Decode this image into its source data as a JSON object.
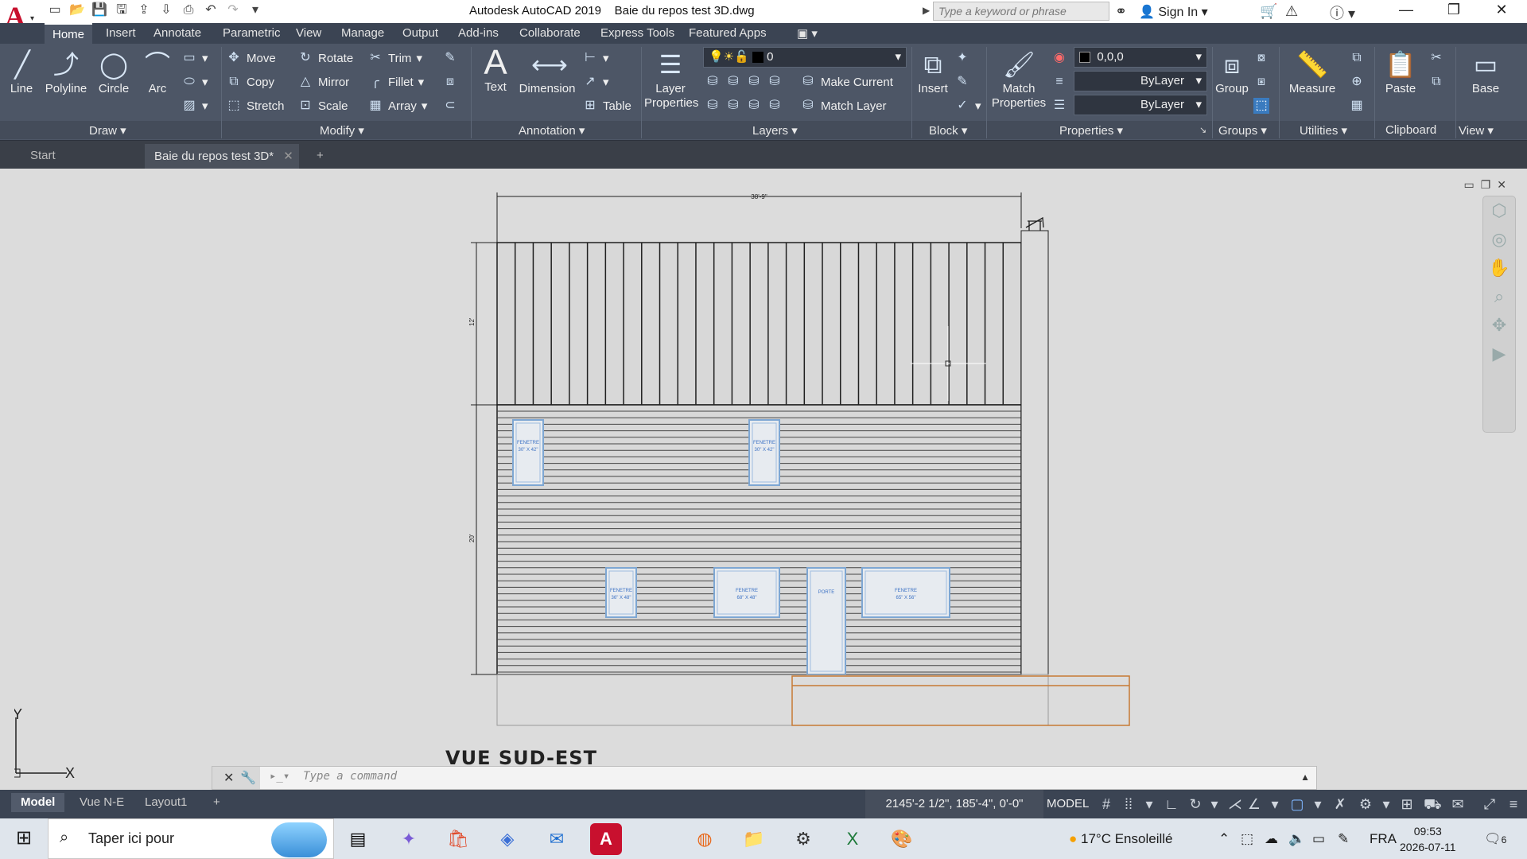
{
  "window": {
    "app_title": "Autodesk AutoCAD 2019",
    "file_name": "Baie du repos test 3D.dwg",
    "search_placeholder": "Type a keyword or phrase",
    "sign_in": "Sign In"
  },
  "ribbon_tabs": [
    "Home",
    "Insert",
    "Annotate",
    "Parametric",
    "View",
    "Manage",
    "Output",
    "Add-ins",
    "Collaborate",
    "Express Tools",
    "Featured Apps"
  ],
  "ribbon": {
    "draw": {
      "label": "Draw",
      "line": "Line",
      "polyline": "Polyline",
      "circle": "Circle",
      "arc": "Arc"
    },
    "modify": {
      "label": "Modify",
      "move": "Move",
      "rotate": "Rotate",
      "trim": "Trim",
      "copy": "Copy",
      "mirror": "Mirror",
      "fillet": "Fillet",
      "stretch": "Stretch",
      "scale": "Scale",
      "array": "Array"
    },
    "annotation": {
      "label": "Annotation",
      "text": "Text",
      "dimension": "Dimension",
      "table": "Table"
    },
    "layers": {
      "label": "Layers",
      "layer_properties": "Layer Properties",
      "current_layer": "0",
      "make_current": "Make Current",
      "match_layer": "Match Layer"
    },
    "block": {
      "label": "Block",
      "insert": "Insert"
    },
    "properties": {
      "label": "Properties",
      "match_properties": "Match Properties",
      "color": "0,0,0",
      "linetype": "ByLayer",
      "lineweight": "ByLayer"
    },
    "groups": {
      "label": "Groups",
      "group": "Group"
    },
    "utilities": {
      "label": "Utilities",
      "measure": "Measure"
    },
    "clipboard": {
      "label": "Clipboard",
      "paste": "Paste"
    },
    "view": {
      "label": "View",
      "base": "Base"
    }
  },
  "doc_tabs": {
    "start": "Start",
    "active": "Baie du repos test 3D*"
  },
  "drawing": {
    "overall_dim": "38'-9\"",
    "upper_dim": "12'",
    "lower_dim": "20'",
    "window_labels": [
      "FENETRE\n30\" X 42\"",
      "FENETRE\n30\" X 42\"",
      "FENETRE\n36\" X 48\"",
      "FENETRE\n68\" X 48\"",
      "PORTE",
      "FENETRE\n65\" X 56\""
    ],
    "view_title": "Vue Sud-Est"
  },
  "command_line": {
    "placeholder": "Type a command"
  },
  "ucs": {
    "x": "X",
    "y": "Y"
  },
  "layout_tabs": [
    "Model",
    "Vue N-E",
    "Layout1"
  ],
  "status": {
    "coordinates": "2145'-2 1/2\", 185'-4\", 0'-0\"",
    "space": "MODEL"
  },
  "taskbar": {
    "search_text": "Taper ici pour",
    "weather": "17°C  Ensoleillé",
    "language": "FRA",
    "time": "09:53",
    "date": "2026-07-11",
    "notifications": "6"
  }
}
